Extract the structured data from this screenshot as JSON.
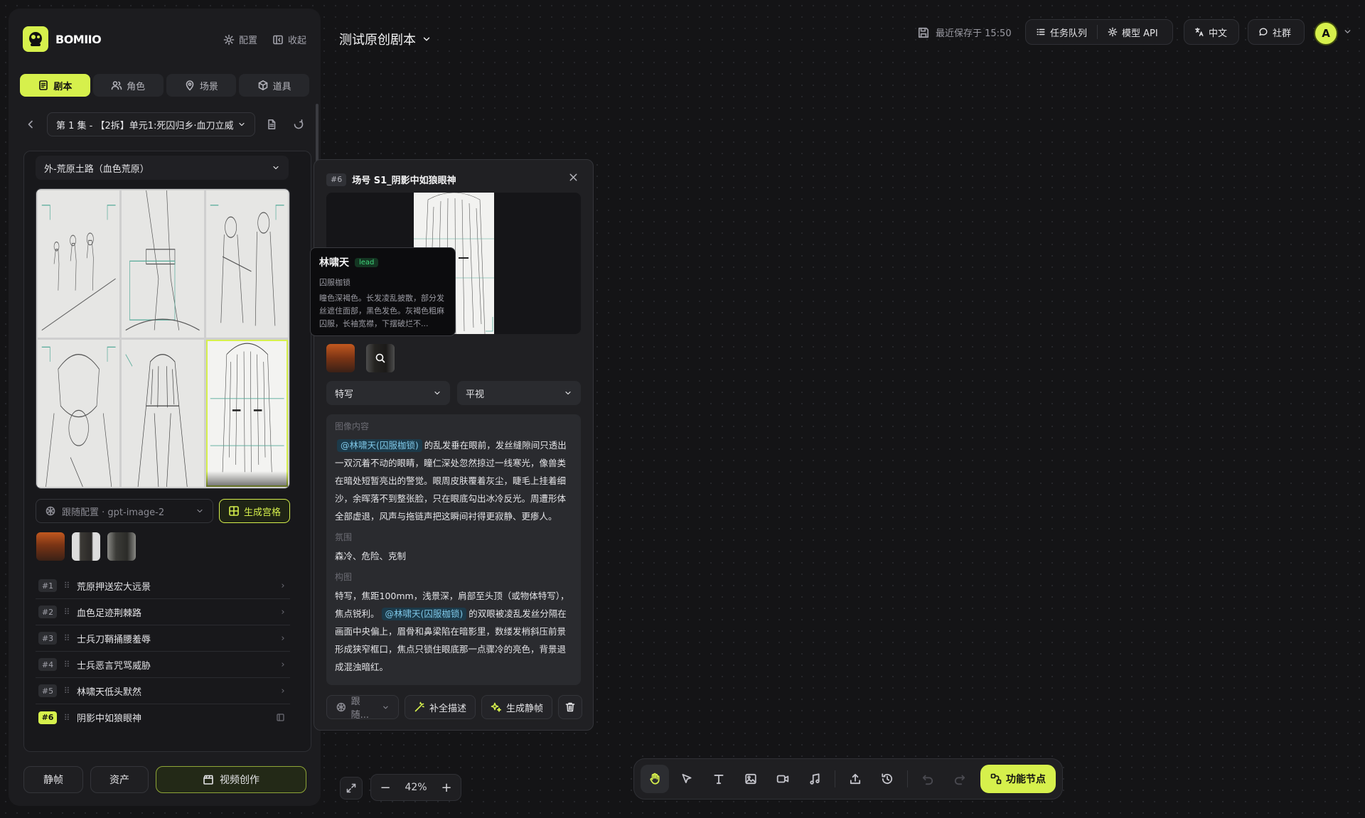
{
  "app": {
    "brand": "BOMIIO",
    "config_label": "配置",
    "collapse_label": "收起",
    "project_title": "测试原创剧本",
    "save_status": "最近保存于 15:50",
    "task_queue_label": "任务队列",
    "model_api_label": "模型 API",
    "language_label": "中文",
    "community_label": "社群",
    "avatar_letter": "A",
    "accent_color": "#d6f04c"
  },
  "sidebar": {
    "tabs": [
      {
        "label": "剧本",
        "icon": "script-icon",
        "active": true
      },
      {
        "label": "角色",
        "icon": "users-icon",
        "active": false
      },
      {
        "label": "场景",
        "icon": "map-pin-icon",
        "active": false
      },
      {
        "label": "道具",
        "icon": "box-icon",
        "active": false
      }
    ],
    "episode_select": "第 1 集 - 【2拆】单元1:死囚归乡·血刀立威",
    "scene_select": "外-荒原土路（血色荒原）",
    "model_select": "跟随配置 · gpt-image-2",
    "generate_grid_label": "生成宫格",
    "shots": [
      {
        "no": "#1",
        "title": "荒原押送宏大远景",
        "active": false
      },
      {
        "no": "#2",
        "title": "血色足迹荆棘路",
        "active": false
      },
      {
        "no": "#3",
        "title": "士兵刀鞘捅腰羞辱",
        "active": false
      },
      {
        "no": "#4",
        "title": "士兵恶言咒骂威胁",
        "active": false
      },
      {
        "no": "#5",
        "title": "林啸天低头默然",
        "active": false
      },
      {
        "no": "#6",
        "title": "阴影中如狼眼神",
        "active": true
      }
    ],
    "bottom": {
      "still_label": "静帧",
      "assets_label": "资产",
      "video_label": "视频创作"
    }
  },
  "detail": {
    "shot_tag": "#6",
    "title": "场号 S1_阴影中如狼眼神",
    "shot_size": "特写",
    "camera_angle": "平视",
    "image_content_label": "图像内容",
    "mention": "@林啸天(囚服枷锁)",
    "image_content_text": "的乱发垂在眼前，发丝缝隙间只透出一双沉着不动的眼睛，瞳仁深处忽然掠过一线寒光，像兽类在暗处短暂亮出的警觉。眼周皮肤覆着灰尘，睫毛上挂着细沙，余晖落不到整张脸，只在眼底勾出冰冷反光。周遭形体全部虚退，风声与拖链声把这瞬间衬得更寂静、更瘆人。",
    "mood_label": "氛围",
    "mood_text": "森冷、危险、克制",
    "composition_label": "构图",
    "composition_text_1": "特写，焦距100mm，浅景深，肩部至头顶（或物体特写），焦点锐利。",
    "composition_mention": "@林啸天(囚服枷锁)",
    "composition_text_2": "的双眼被凌乱发丝分隔在画面中央偏上，眉骨和鼻梁陷在暗影里，数缕发梢斜压前景形成狭窄框口，焦点只锁住眼底那一点骤冷的亮色，背景退成混浊暗红。",
    "model_short": "跟随...",
    "complete_desc_label": "补全描述",
    "gen_still_label": "生成静帧"
  },
  "tooltip": {
    "name": "林啸天",
    "badge": "lead",
    "subtitle": "囚服枷锁",
    "desc": "瞳色深褐色。长发凌乱披散，部分发丝遮住面部，黑色发色。灰褐色粗麻囚服，长袖宽襟，下摆破烂不..."
  },
  "canvas": {
    "zoom": "42%",
    "function_node_label": "功能节点"
  }
}
